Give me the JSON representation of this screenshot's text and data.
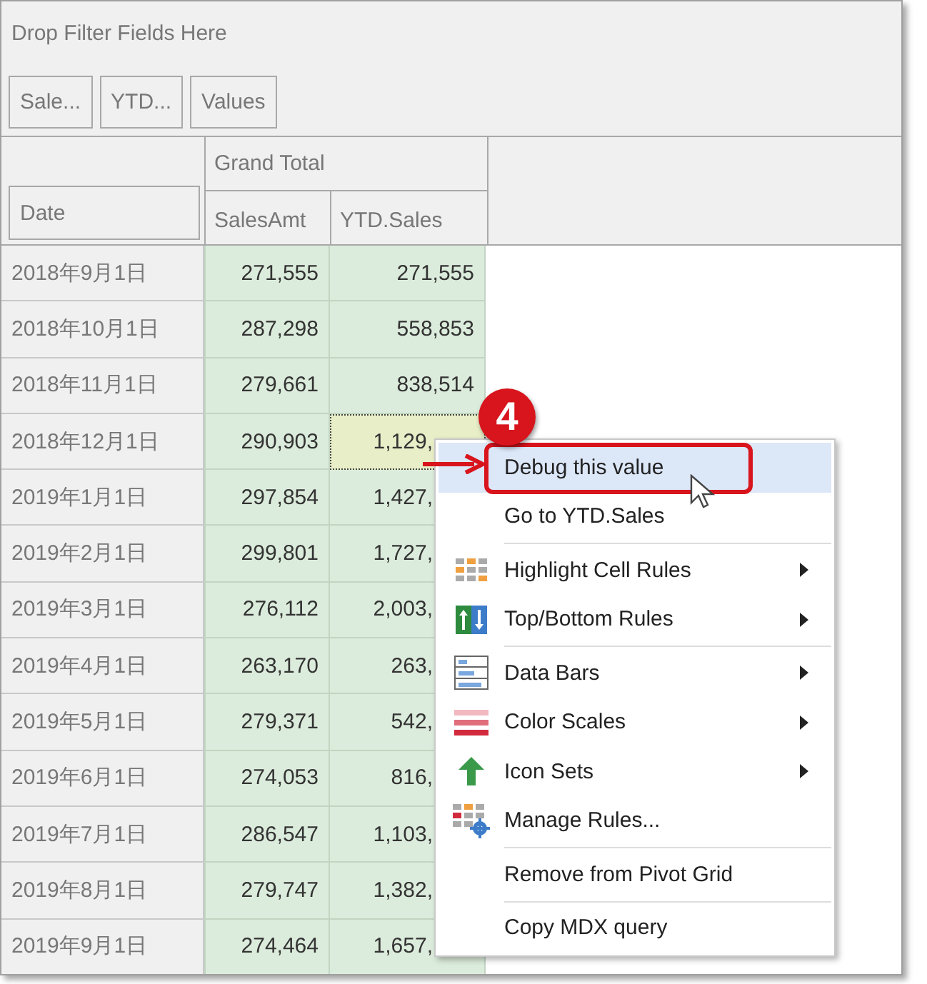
{
  "filter_area": {
    "placeholder": "Drop Filter Fields Here"
  },
  "field_buttons": [
    "Sale...",
    "YTD...",
    "Values"
  ],
  "row_field": "Date",
  "column_header": "Grand Total",
  "columns": [
    "SalesAmt",
    "YTD.Sales"
  ],
  "rows": [
    {
      "date": "2018年9月1日",
      "sales_amt": "271,555",
      "ytd_sales": "271,555",
      "selected": false
    },
    {
      "date": "2018年10月1日",
      "sales_amt": "287,298",
      "ytd_sales": "558,853",
      "selected": false
    },
    {
      "date": "2018年11月1日",
      "sales_amt": "279,661",
      "ytd_sales": "838,514",
      "selected": false
    },
    {
      "date": "2018年12月1日",
      "sales_amt": "290,903",
      "ytd_sales": "1,129,",
      "selected": true
    },
    {
      "date": "2019年1月1日",
      "sales_amt": "297,854",
      "ytd_sales": "1,427,",
      "selected": false
    },
    {
      "date": "2019年2月1日",
      "sales_amt": "299,801",
      "ytd_sales": "1,727,",
      "selected": false
    },
    {
      "date": "2019年3月1日",
      "sales_amt": "276,112",
      "ytd_sales": "2,003,",
      "selected": false
    },
    {
      "date": "2019年4月1日",
      "sales_amt": "263,170",
      "ytd_sales": "263,",
      "selected": false
    },
    {
      "date": "2019年5月1日",
      "sales_amt": "279,371",
      "ytd_sales": "542,",
      "selected": false
    },
    {
      "date": "2019年6月1日",
      "sales_amt": "274,053",
      "ytd_sales": "816,",
      "selected": false
    },
    {
      "date": "2019年7月1日",
      "sales_amt": "286,547",
      "ytd_sales": "1,103,",
      "selected": false
    },
    {
      "date": "2019年8月1日",
      "sales_amt": "279,747",
      "ytd_sales": "1,382,",
      "selected": false
    },
    {
      "date": "2019年9月1日",
      "sales_amt": "274,464",
      "ytd_sales": "1,657,",
      "selected": false
    }
  ],
  "context_menu": {
    "groups": [
      [
        {
          "label": "Debug this value",
          "highlighted": true,
          "submenu": false
        },
        {
          "label": "Go to YTD.Sales",
          "highlighted": false,
          "submenu": false
        }
      ],
      [
        {
          "label": "Highlight Cell Rules",
          "highlighted": false,
          "submenu": true
        },
        {
          "label": "Top/Bottom Rules",
          "highlighted": false,
          "submenu": true
        }
      ],
      [
        {
          "label": "Data Bars",
          "highlighted": false,
          "submenu": true
        },
        {
          "label": "Color Scales",
          "highlighted": false,
          "submenu": true
        },
        {
          "label": "Icon Sets",
          "highlighted": false,
          "submenu": true
        },
        {
          "label": "Manage Rules...",
          "highlighted": false,
          "submenu": false
        }
      ],
      [
        {
          "label": "Remove from Pivot Grid",
          "highlighted": false,
          "submenu": false
        }
      ],
      [
        {
          "label": "Copy MDX query",
          "highlighted": false,
          "submenu": false
        }
      ]
    ]
  },
  "step_badge": "4"
}
